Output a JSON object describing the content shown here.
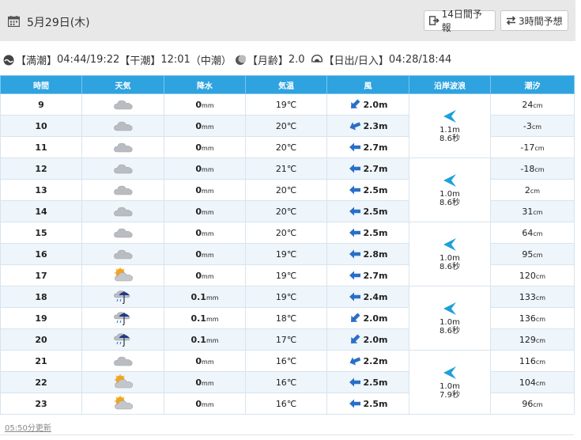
{
  "header": {
    "date": "5月29日(木)",
    "btn_14day": "14日間予報",
    "btn_3hour": "3時間予想"
  },
  "info": {
    "high_tide_label": "【満潮】",
    "high_tide": "04:44/19:22",
    "low_tide_label": "【干潮】",
    "low_tide": "12:01",
    "tide_type": "（中潮）",
    "moon_label": "【月齢】",
    "moon": "2.0",
    "sun_label": "【日出/日入】",
    "sun": "04:28/18:44"
  },
  "columns": [
    "時間",
    "天気",
    "降水",
    "気温",
    "風",
    "沿岸波浪",
    "潮汐"
  ],
  "rows": [
    {
      "hour": "9",
      "weather": "cloudy",
      "precip": "0",
      "temp": "19",
      "wind_dir": "sw",
      "wind": "2.0m",
      "tide": "24"
    },
    {
      "hour": "10",
      "weather": "cloudy",
      "precip": "0",
      "temp": "20",
      "wind_dir": "wsw",
      "wind": "2.3m",
      "tide": "-3"
    },
    {
      "hour": "11",
      "weather": "cloudy",
      "precip": "0",
      "temp": "20",
      "wind_dir": "w",
      "wind": "2.7m",
      "tide": "-17"
    },
    {
      "hour": "12",
      "weather": "cloudy",
      "precip": "0",
      "temp": "21",
      "wind_dir": "w",
      "wind": "2.7m",
      "tide": "-18"
    },
    {
      "hour": "13",
      "weather": "cloudy",
      "precip": "0",
      "temp": "20",
      "wind_dir": "w",
      "wind": "2.5m",
      "tide": "2"
    },
    {
      "hour": "14",
      "weather": "cloudy",
      "precip": "0",
      "temp": "20",
      "wind_dir": "w",
      "wind": "2.5m",
      "tide": "31"
    },
    {
      "hour": "15",
      "weather": "cloudy",
      "precip": "0",
      "temp": "20",
      "wind_dir": "w",
      "wind": "2.5m",
      "tide": "64"
    },
    {
      "hour": "16",
      "weather": "cloudy",
      "precip": "0",
      "temp": "19",
      "wind_dir": "w",
      "wind": "2.8m",
      "tide": "95"
    },
    {
      "hour": "17",
      "weather": "partly-sunny",
      "precip": "0",
      "temp": "19",
      "wind_dir": "w",
      "wind": "2.7m",
      "tide": "120"
    },
    {
      "hour": "18",
      "weather": "cloudy-rain",
      "precip": "0.1",
      "temp": "19",
      "wind_dir": "w",
      "wind": "2.4m",
      "tide": "133"
    },
    {
      "hour": "19",
      "weather": "cloudy-rain",
      "precip": "0.1",
      "temp": "18",
      "wind_dir": "sw",
      "wind": "2.0m",
      "tide": "136"
    },
    {
      "hour": "20",
      "weather": "cloudy-rain",
      "precip": "0.1",
      "temp": "17",
      "wind_dir": "sw",
      "wind": "2.0m",
      "tide": "129"
    },
    {
      "hour": "21",
      "weather": "cloudy",
      "precip": "0",
      "temp": "16",
      "wind_dir": "wsw",
      "wind": "2.2m",
      "tide": "116"
    },
    {
      "hour": "22",
      "weather": "partly-sunny",
      "precip": "0",
      "temp": "16",
      "wind_dir": "w",
      "wind": "2.5m",
      "tide": "104"
    },
    {
      "hour": "23",
      "weather": "partly-sunny",
      "precip": "0",
      "temp": "16",
      "wind_dir": "w",
      "wind": "2.5m",
      "tide": "96"
    }
  ],
  "waves": [
    {
      "height": "1.1m",
      "period": "8.6秒"
    },
    {
      "height": "1.0m",
      "period": "8.6秒"
    },
    {
      "height": "1.0m",
      "period": "8.6秒"
    },
    {
      "height": "1.0m",
      "period": "8.6秒"
    },
    {
      "height": "1.0m",
      "period": "7.9秒"
    }
  ],
  "units": {
    "precip": "mm",
    "temp": "℃",
    "tide": "cm"
  },
  "updated": "05:50分更新",
  "colors": {
    "header_blue": "#2ea3e0",
    "arrow_blue": "#2a6fc7",
    "wave_blue": "#1ea0d8",
    "stripe": "#eef5fb"
  }
}
